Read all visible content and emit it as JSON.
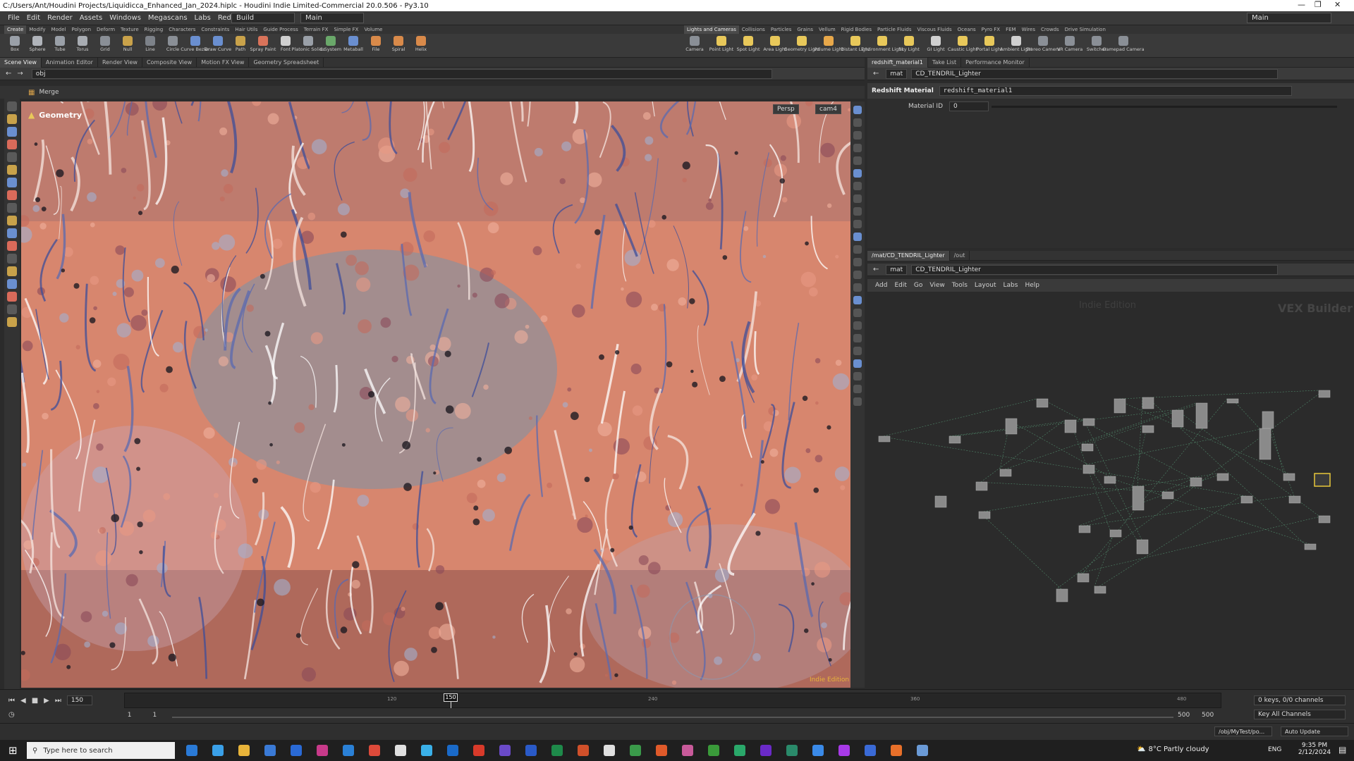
{
  "window": {
    "title": "C:/Users/Ant/Houdini Projects/Liquidicca_Enhanced_Jan_2024.hiplc - Houdini Indie Limited-Commercial 20.0.506 - Py3.10"
  },
  "menu": {
    "items": [
      "File",
      "Edit",
      "Render",
      "Assets",
      "Windows",
      "Megascans",
      "Labs",
      "Redshift",
      "Help"
    ],
    "desktop": "Build",
    "desktop2": "Main",
    "right_combo": "Main"
  },
  "shelf_tabs_left": [
    "Create",
    "Modify",
    "Model",
    "Polygon",
    "Deform",
    "Texture",
    "Rigging",
    "Characters",
    "Constraints",
    "Hair Utils",
    "Guide Process",
    "Terrain FX",
    "Simple FX",
    "Volume"
  ],
  "shelf_tabs_right": [
    "Lights and Cameras",
    "Collisions",
    "Particles",
    "Grains",
    "Vellum",
    "Rigid Bodies",
    "Particle Fluids",
    "Viscous Fluids",
    "Oceans",
    "Pyro FX",
    "FEM",
    "Wires",
    "Crowds",
    "Drive Simulation"
  ],
  "tools_left": [
    {
      "label": "Box",
      "color": "#9aa0a8"
    },
    {
      "label": "Sphere",
      "color": "#b0b4ba"
    },
    {
      "label": "Tube",
      "color": "#9aa0a8"
    },
    {
      "label": "Torus",
      "color": "#a8acb2"
    },
    {
      "label": "Grid",
      "color": "#8a8f96"
    },
    {
      "label": "Null",
      "color": "#c9a24a"
    },
    {
      "label": "Line",
      "color": "#7d8289"
    },
    {
      "label": "Circle",
      "color": "#8a8f96"
    },
    {
      "label": "Curve Bezier",
      "color": "#6a8fd0"
    },
    {
      "label": "Draw Curve",
      "color": "#6a8fd0"
    },
    {
      "label": "Path",
      "color": "#c9a24a"
    },
    {
      "label": "Spray Paint",
      "color": "#d9735a"
    },
    {
      "label": "Font",
      "color": "#d0d0d0"
    },
    {
      "label": "Platonic Solids",
      "color": "#9aa0a8"
    },
    {
      "label": "L-System",
      "color": "#6aa86a"
    },
    {
      "label": "Metaball",
      "color": "#6a8fd0"
    },
    {
      "label": "File",
      "color": "#d98a4a"
    },
    {
      "label": "Spiral",
      "color": "#d98a4a"
    },
    {
      "label": "Helix",
      "color": "#d98a4a"
    }
  ],
  "tools_right": [
    {
      "label": "Camera",
      "color": "#8a8f96"
    },
    {
      "label": "Point Light",
      "color": "#e8c85a"
    },
    {
      "label": "Spot Light",
      "color": "#e8c85a"
    },
    {
      "label": "Area Light",
      "color": "#e8c85a"
    },
    {
      "label": "Geometry Light",
      "color": "#e8c85a"
    },
    {
      "label": "Volume Light",
      "color": "#e8a84a"
    },
    {
      "label": "Distant Light",
      "color": "#e8c85a"
    },
    {
      "label": "Environment Light",
      "color": "#e8c85a"
    },
    {
      "label": "Sky Light",
      "color": "#e8c85a"
    },
    {
      "label": "GI Light",
      "color": "#d0d0d0"
    },
    {
      "label": "Caustic Light",
      "color": "#e8c85a"
    },
    {
      "label": "Portal Light",
      "color": "#e8c85a"
    },
    {
      "label": "Ambient Light",
      "color": "#d0d0d0"
    },
    {
      "label": "Stereo Camera",
      "color": "#8a8f96"
    },
    {
      "label": "VR Camera",
      "color": "#8a8f96"
    },
    {
      "label": "Switcher",
      "color": "#8a8f96"
    },
    {
      "label": "Gamepad Camera",
      "color": "#8a8f96"
    }
  ],
  "left_pane": {
    "tabs": [
      "Scene View",
      "Animation Editor",
      "Render View",
      "Composite View",
      "Motion FX View",
      "Geometry Spreadsheet"
    ],
    "path": "obj",
    "node": "Merge",
    "overlay": "Geometry",
    "persp": "Persp",
    "cam": "cam4",
    "watermark": "Indie Edition"
  },
  "param_pane": {
    "tabs": [
      "redshift_material1",
      "Take List",
      "Performance Monitor"
    ],
    "ctx": "mat",
    "node": "CD_TENDRIL_Lighter",
    "type_label": "Redshift Material",
    "name": "redshift_material1",
    "param_label": "Material ID",
    "param_value": "0"
  },
  "network_pane": {
    "tabs": [
      "/mat/CD_TENDRIL_Lighter",
      "/out"
    ],
    "ctx": "mat",
    "node": "CD_TENDRIL_Lighter",
    "menu": [
      "Add",
      "Edit",
      "Go",
      "View",
      "Tools",
      "Layout",
      "Labs",
      "Help"
    ],
    "watermark": "Indie Edition",
    "builder": "VEX Builder"
  },
  "timeline": {
    "frame": "150",
    "marker": "150",
    "ticks": [
      "120",
      "240",
      "360",
      "480"
    ],
    "start": "1",
    "start2": "1",
    "end": "500",
    "end2": "500",
    "keys": "0 keys, 0/0 channels",
    "key_all": "Key All Channels",
    "path": "/obj/MyTest/po...",
    "auto": "Auto Update"
  },
  "taskbar": {
    "search": "Type here to search",
    "weather": "8°C  Partly cloudy",
    "lang": "ENG",
    "time": "9:35 PM",
    "date": "2/12/2024",
    "apps": [
      {
        "color": "#2a7ad6"
      },
      {
        "color": "#3aa0e8"
      },
      {
        "color": "#e8b43a"
      },
      {
        "color": "#3a7ad6"
      },
      {
        "color": "#2a6ad6"
      },
      {
        "color": "#c83a8a"
      },
      {
        "color": "#2a80d6"
      },
      {
        "color": "#dd4a3a"
      },
      {
        "color": "#e0e0e0"
      },
      {
        "color": "#3ab0e8"
      },
      {
        "color": "#1a6ac8"
      },
      {
        "color": "#d83a2a"
      },
      {
        "color": "#6a4ac8"
      },
      {
        "color": "#2a5ac8"
      },
      {
        "color": "#1e8a4a"
      },
      {
        "color": "#d0502a"
      },
      {
        "color": "#e0e0e0"
      },
      {
        "color": "#3a9a4a"
      },
      {
        "color": "#e05a2a"
      },
      {
        "color": "#c85a9a"
      },
      {
        "color": "#3a9a3a"
      },
      {
        "color": "#2aa86a"
      },
      {
        "color": "#6a2ac8"
      },
      {
        "color": "#2a8a6a"
      },
      {
        "color": "#3a8ae8"
      },
      {
        "color": "#a83ae8"
      },
      {
        "color": "#3a6ad6"
      },
      {
        "color": "#e8702a"
      },
      {
        "color": "#6a9ad6"
      }
    ]
  }
}
